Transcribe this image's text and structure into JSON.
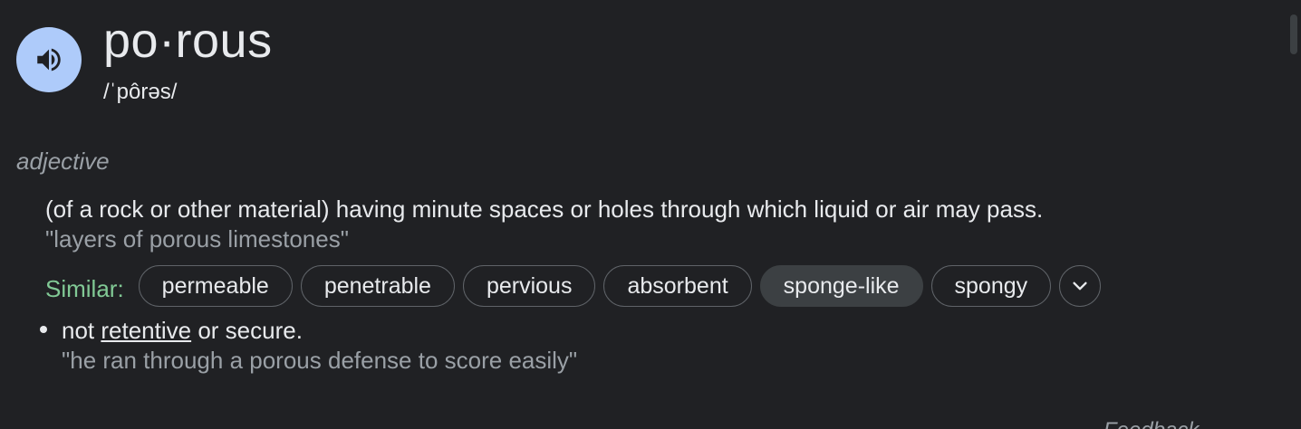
{
  "entry": {
    "headword": "po·rous",
    "phonetic": "/ˈpôrəs/",
    "speaker_icon": "volume-up-icon"
  },
  "sense": {
    "part_of_speech": "adjective",
    "definitions": [
      {
        "text": "(of a rock or other material) having minute spaces or holes through which liquid or air may pass.",
        "example": "\"layers of porous limestones\""
      },
      {
        "prefix": "not ",
        "link": "retentive",
        "suffix": " or secure.",
        "example": "\"he ran through a porous defense to score easily\""
      }
    ]
  },
  "similar": {
    "label": "Similar:",
    "words": [
      "permeable",
      "penetrable",
      "pervious",
      "absorbent",
      "sponge-like",
      "spongy"
    ],
    "highlighted": "sponge-like",
    "expand_icon": "chevron-down-icon"
  },
  "footer": {
    "feedback_label": "Feedback"
  },
  "colors": {
    "background": "#202124",
    "text": "#e8eaed",
    "muted": "#9aa0a6",
    "similar_label": "#81c995",
    "speaker_bg": "#aecbfa"
  }
}
